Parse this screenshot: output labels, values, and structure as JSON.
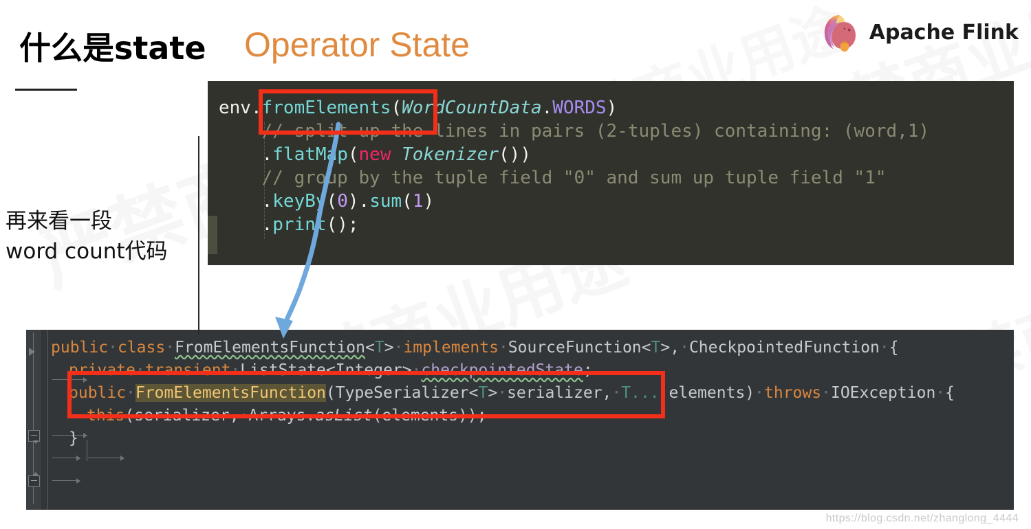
{
  "slide": {
    "title_cn": "什么是state",
    "title_en": "Operator State",
    "side_note_line1": "再来看一段",
    "side_note_line2": "word count代码",
    "watermark_text": "严禁商业用途",
    "footer_watermark": "https://blog.csdn.net/zhanglong_4444"
  },
  "brand": {
    "name": "Apache Flink",
    "logo_icon": "flink-squirrel-icon",
    "accent_color": "#e08a40"
  },
  "code_top": {
    "language": "java",
    "lines": [
      {
        "tokens": [
          {
            "t": "env",
            "c": "t-plain"
          },
          {
            "t": ".",
            "c": "t-plain"
          },
          {
            "t": "fromElements",
            "c": "t-fn"
          },
          {
            "t": "(",
            "c": "t-paren"
          },
          {
            "t": "WordCountData",
            "c": "t-cls"
          },
          {
            "t": ".",
            "c": "t-plain"
          },
          {
            "t": "WORDS",
            "c": "t-const"
          },
          {
            "t": ")",
            "c": "t-paren"
          }
        ]
      },
      {
        "tokens": [
          {
            "t": "    // split up the lines in pairs (2-tuples) containing: (word,1)",
            "c": "t-cmt"
          }
        ]
      },
      {
        "tokens": [
          {
            "t": "    .",
            "c": "t-plain"
          },
          {
            "t": "flatMap",
            "c": "t-fn"
          },
          {
            "t": "(",
            "c": "t-paren"
          },
          {
            "t": "new",
            "c": "t-kw"
          },
          {
            "t": " ",
            "c": "t-plain"
          },
          {
            "t": "Tokenizer",
            "c": "t-cls"
          },
          {
            "t": "())",
            "c": "t-paren"
          }
        ]
      },
      {
        "tokens": [
          {
            "t": "    // group by the tuple field \"0\" and sum up tuple field \"1\"",
            "c": "t-cmt"
          }
        ]
      },
      {
        "tokens": [
          {
            "t": "    .",
            "c": "t-plain"
          },
          {
            "t": "keyBy",
            "c": "t-fn"
          },
          {
            "t": "(",
            "c": "t-paren"
          },
          {
            "t": "0",
            "c": "t-num"
          },
          {
            "t": ").",
            "c": "t-paren"
          },
          {
            "t": "sum",
            "c": "t-fn"
          },
          {
            "t": "(",
            "c": "t-paren"
          },
          {
            "t": "1",
            "c": "t-num"
          },
          {
            "t": ")",
            "c": "t-paren"
          }
        ]
      },
      {
        "tokens": [
          {
            "t": "    .",
            "c": "t-plain"
          },
          {
            "t": "print",
            "c": "t-fn"
          },
          {
            "t": "();",
            "c": "t-paren"
          }
        ]
      }
    ],
    "highlight_token": "fromElements"
  },
  "code_bottom": {
    "language": "java",
    "lines": [
      {
        "tokens": [
          {
            "t": "public",
            "c": "b-kw"
          },
          {
            "t": "·",
            "c": "dot"
          },
          {
            "t": "class",
            "c": "b-kw"
          },
          {
            "t": "·",
            "c": "dot"
          },
          {
            "t": "FromElementsFunction",
            "c": "b-id sq-g"
          },
          {
            "t": "<",
            "c": "b-punct"
          },
          {
            "t": "T",
            "c": "b-gen"
          },
          {
            "t": ">",
            "c": "b-punct"
          },
          {
            "t": "·",
            "c": "dot"
          },
          {
            "t": "implements",
            "c": "b-kw"
          },
          {
            "t": "·",
            "c": "dot"
          },
          {
            "t": "SourceFunction",
            "c": "b-id"
          },
          {
            "t": "<",
            "c": "b-punct"
          },
          {
            "t": "T",
            "c": "b-gen"
          },
          {
            "t": ">,",
            "c": "b-punct"
          },
          {
            "t": "·",
            "c": "dot"
          },
          {
            "t": "CheckpointedFunction",
            "c": "b-id"
          },
          {
            "t": "·",
            "c": "dot"
          },
          {
            "t": "{",
            "c": "b-punct"
          }
        ]
      },
      {
        "tokens": [
          {
            "t": "private",
            "c": "b-kw"
          },
          {
            "t": "·",
            "c": "dot"
          },
          {
            "t": "transient",
            "c": "b-kw"
          },
          {
            "t": "·",
            "c": "dot"
          },
          {
            "t": "ListState",
            "c": "b-id"
          },
          {
            "t": "<",
            "c": "b-punct"
          },
          {
            "t": "Integer",
            "c": "b-id"
          },
          {
            "t": ">",
            "c": "b-punct"
          },
          {
            "t": "·",
            "c": "dot"
          },
          {
            "t": "checkpointedState",
            "c": "b-field sq-g"
          },
          {
            "t": ";",
            "c": "b-punct"
          }
        ],
        "indent": 1
      },
      {
        "tokens": [
          {
            "t": "public",
            "c": "b-kw"
          },
          {
            "t": "·",
            "c": "dot"
          },
          {
            "t": "FromElementsFunction",
            "c": "b-hl"
          },
          {
            "t": "(",
            "c": "b-punct"
          },
          {
            "t": "TypeSerializer",
            "c": "b-id"
          },
          {
            "t": "<",
            "c": "b-punct"
          },
          {
            "t": "T",
            "c": "b-gen"
          },
          {
            "t": ">",
            "c": "b-punct"
          },
          {
            "t": "·",
            "c": "dot"
          },
          {
            "t": "serializer,",
            "c": "b-id"
          },
          {
            "t": "·",
            "c": "dot"
          },
          {
            "t": "T...",
            "c": "b-gen"
          },
          {
            "t": "·",
            "c": "dot"
          },
          {
            "t": "elements",
            "c": "b-id"
          },
          {
            "t": ")",
            "c": "b-punct"
          },
          {
            "t": "·",
            "c": "dot"
          },
          {
            "t": "throws",
            "c": "b-kw"
          },
          {
            "t": "·",
            "c": "dot"
          },
          {
            "t": "IOException",
            "c": "b-id"
          },
          {
            "t": "·",
            "c": "dot"
          },
          {
            "t": "{",
            "c": "b-punct"
          }
        ],
        "indent": 1
      },
      {
        "tokens": [
          {
            "t": "this",
            "c": "b-kw"
          },
          {
            "t": "(serializer,",
            "c": "b-id"
          },
          {
            "t": "·",
            "c": "dot"
          },
          {
            "t": "Arrays.",
            "c": "b-id"
          },
          {
            "t": "asList",
            "c": "b-id b-italic"
          },
          {
            "t": "(elements));",
            "c": "b-id"
          }
        ],
        "indent": 2
      },
      {
        "tokens": [
          {
            "t": "}",
            "c": "b-punct"
          }
        ],
        "indent": 1
      }
    ],
    "highlight_line_index": 1,
    "highlight_token": "private transient ListState<Integer> checkpointedState;"
  },
  "annotations": {
    "red_box_color": "#f42f19",
    "arrow_color": "#6fa8dc",
    "arrow_label": "fromElements-to-FromElementsFunction-arrow"
  }
}
